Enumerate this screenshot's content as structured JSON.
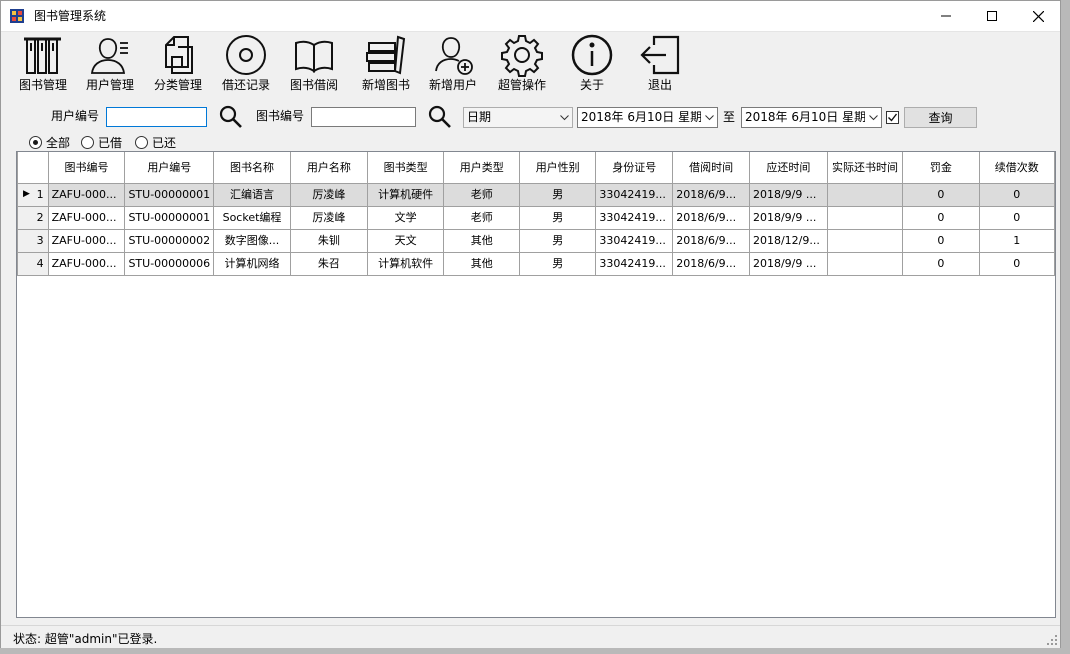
{
  "window": {
    "title": "图书管理系统"
  },
  "toolbar": [
    {
      "label": "图书管理",
      "icon": "books-icon"
    },
    {
      "label": "用户管理",
      "icon": "user-list-icon"
    },
    {
      "label": "分类管理",
      "icon": "documents-icon"
    },
    {
      "label": "借还记录",
      "icon": "disc-icon"
    },
    {
      "label": "图书借阅",
      "icon": "open-book-icon"
    },
    {
      "label": "新增图书",
      "icon": "book-stack-icon"
    },
    {
      "label": "新增用户",
      "icon": "add-user-icon"
    },
    {
      "label": "超管操作",
      "icon": "gear-icon"
    },
    {
      "label": "关于",
      "icon": "info-icon"
    },
    {
      "label": "退出",
      "icon": "exit-icon"
    }
  ],
  "filters": {
    "user_no_label": "用户编号",
    "user_no_value": "",
    "book_no_label": "图书编号",
    "book_no_value": "",
    "date_type": "日期",
    "date_from": "2018年 6月10日 星期日",
    "to_label": "至",
    "date_to": "2018年 6月10日 星期日",
    "date_checked": true,
    "query_label": "查询",
    "radios": [
      {
        "label": "全部",
        "checked": true
      },
      {
        "label": "已借",
        "checked": false
      },
      {
        "label": "已还",
        "checked": false
      }
    ]
  },
  "table": {
    "columns": [
      "图书编号",
      "用户编号",
      "图书名称",
      "用户名称",
      "图书类型",
      "用户类型",
      "用户性别",
      "身份证号",
      "借阅时间",
      "应还时间",
      "实际还书时间",
      "罚金",
      "续借次数"
    ],
    "rows": [
      [
        "1",
        "ZAFU-000...",
        "STU-00000001",
        "汇编语言",
        "厉凌峰",
        "计算机硬件",
        "老师",
        "男",
        "33042419...",
        "2018/6/9...",
        "2018/9/9 ...",
        "",
        "0",
        "0"
      ],
      [
        "2",
        "ZAFU-000...",
        "STU-00000001",
        "Socket编程",
        "厉凌峰",
        "文学",
        "老师",
        "男",
        "33042419...",
        "2018/6/9...",
        "2018/9/9 ...",
        "",
        "0",
        "0"
      ],
      [
        "3",
        "ZAFU-000...",
        "STU-00000002",
        "数字图像...",
        "朱钏",
        "天文",
        "其他",
        "男",
        "33042419...",
        "2018/6/9...",
        "2018/12/9...",
        "",
        "0",
        "1"
      ],
      [
        "4",
        "ZAFU-000...",
        "STU-00000006",
        "计算机网络",
        "朱召",
        "计算机软件",
        "其他",
        "男",
        "33042419...",
        "2018/6/9...",
        "2018/9/9 ...",
        "",
        "0",
        "0"
      ]
    ]
  },
  "status": {
    "text": "状态: 超管\"admin\"已登录."
  }
}
